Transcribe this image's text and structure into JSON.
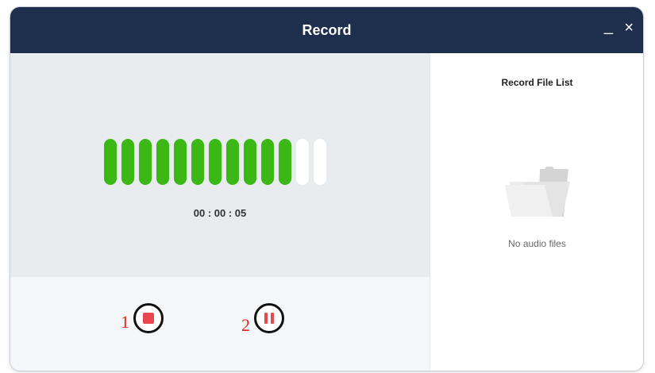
{
  "window": {
    "title": "Record"
  },
  "titlebar": {
    "minimize_icon": "minimize-icon",
    "close_icon": "close-icon",
    "minimize_glyph": "_",
    "close_glyph": "×"
  },
  "recorder": {
    "timer": "00 : 00 : 05",
    "level": {
      "active_bars": 11,
      "total_bars": 13
    },
    "active_color": "#3cb816",
    "inactive_color": "#ffffff"
  },
  "controls": {
    "stop_icon": "stop-icon",
    "pause_icon": "pause-icon",
    "annotation_1": "1",
    "annotation_2": "2"
  },
  "file_list": {
    "title": "Record File List",
    "empty_icon": "folder-icon",
    "empty_text": "No audio files"
  },
  "colors": {
    "titlebar": "#1e2f4d",
    "accent_red": "#e8474f",
    "annotation_red": "#e0241b"
  }
}
